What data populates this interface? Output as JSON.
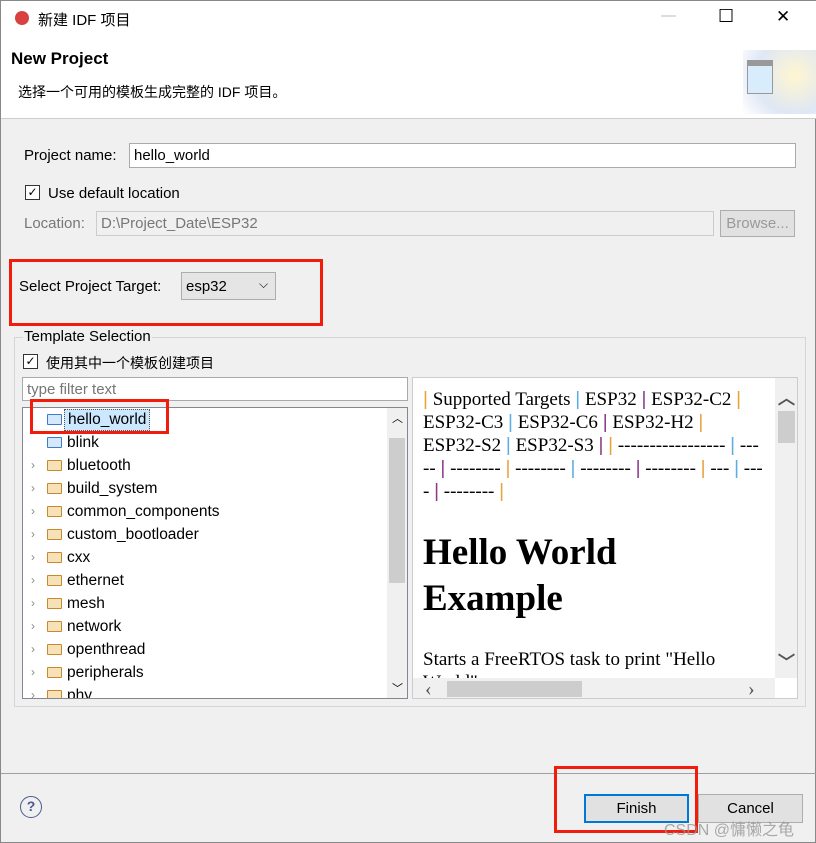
{
  "window": {
    "title": "新建 IDF 项目",
    "minimize": "—",
    "maximize": "☐",
    "close": "✕"
  },
  "header": {
    "title": "New Project",
    "description": "选择一个可用的模板生成完整的 IDF 项目。"
  },
  "form": {
    "project_name_label": "Project name:",
    "project_name_value": "hello_world",
    "use_default_label": "Use default location",
    "use_default_checked": true,
    "location_label": "Location:",
    "location_value": "D:\\Project_Date\\ESP32",
    "browse_label": "Browse...",
    "target_label": "Select Project Target:",
    "target_value": "esp32"
  },
  "template": {
    "group_label": "Template Selection",
    "use_template_label": "使用其中一个模板创建项目",
    "use_template_checked": true,
    "filter_placeholder": "type filter text",
    "items": [
      {
        "label": "hello_world",
        "expandable": false,
        "selected": true
      },
      {
        "label": "blink",
        "expandable": false
      },
      {
        "label": "bluetooth",
        "expandable": true
      },
      {
        "label": "build_system",
        "expandable": true
      },
      {
        "label": "common_components",
        "expandable": true
      },
      {
        "label": "custom_bootloader",
        "expandable": true
      },
      {
        "label": "cxx",
        "expandable": true
      },
      {
        "label": "ethernet",
        "expandable": true
      },
      {
        "label": "mesh",
        "expandable": true
      },
      {
        "label": "network",
        "expandable": true
      },
      {
        "label": "openthread",
        "expandable": true
      },
      {
        "label": "peripherals",
        "expandable": true
      },
      {
        "label": "phy",
        "expandable": true
      }
    ]
  },
  "preview": {
    "table_line1": [
      "Supported Targets",
      "ESP32",
      "ESP32-C2"
    ],
    "table_line2": [
      "ESP32-C3",
      "ESP32-C6",
      "ESP32-H2"
    ],
    "table_line3": [
      "ESP32-S2",
      "ESP32-S3",
      "",
      "-----------------"
    ],
    "table_line4": [
      "-----",
      "--------",
      "--------",
      "--------",
      "--------",
      "---"
    ],
    "table_line5": [
      "----",
      "--------"
    ],
    "heading": "Hello World Example",
    "body": "Starts a FreeRTOS task to print \"Hello World\"",
    "sep_colors": [
      "#e8a33d",
      "#5aaee0",
      "#8a3a8a"
    ]
  },
  "footer": {
    "help": "?",
    "finish_label": "Finish",
    "cancel_label": "Cancel"
  },
  "watermark": "CSDN @慵懒之龟",
  "colors": {
    "highlight": "#f21c0d",
    "selection": "#cce8ff",
    "focus": "#0078d7"
  }
}
